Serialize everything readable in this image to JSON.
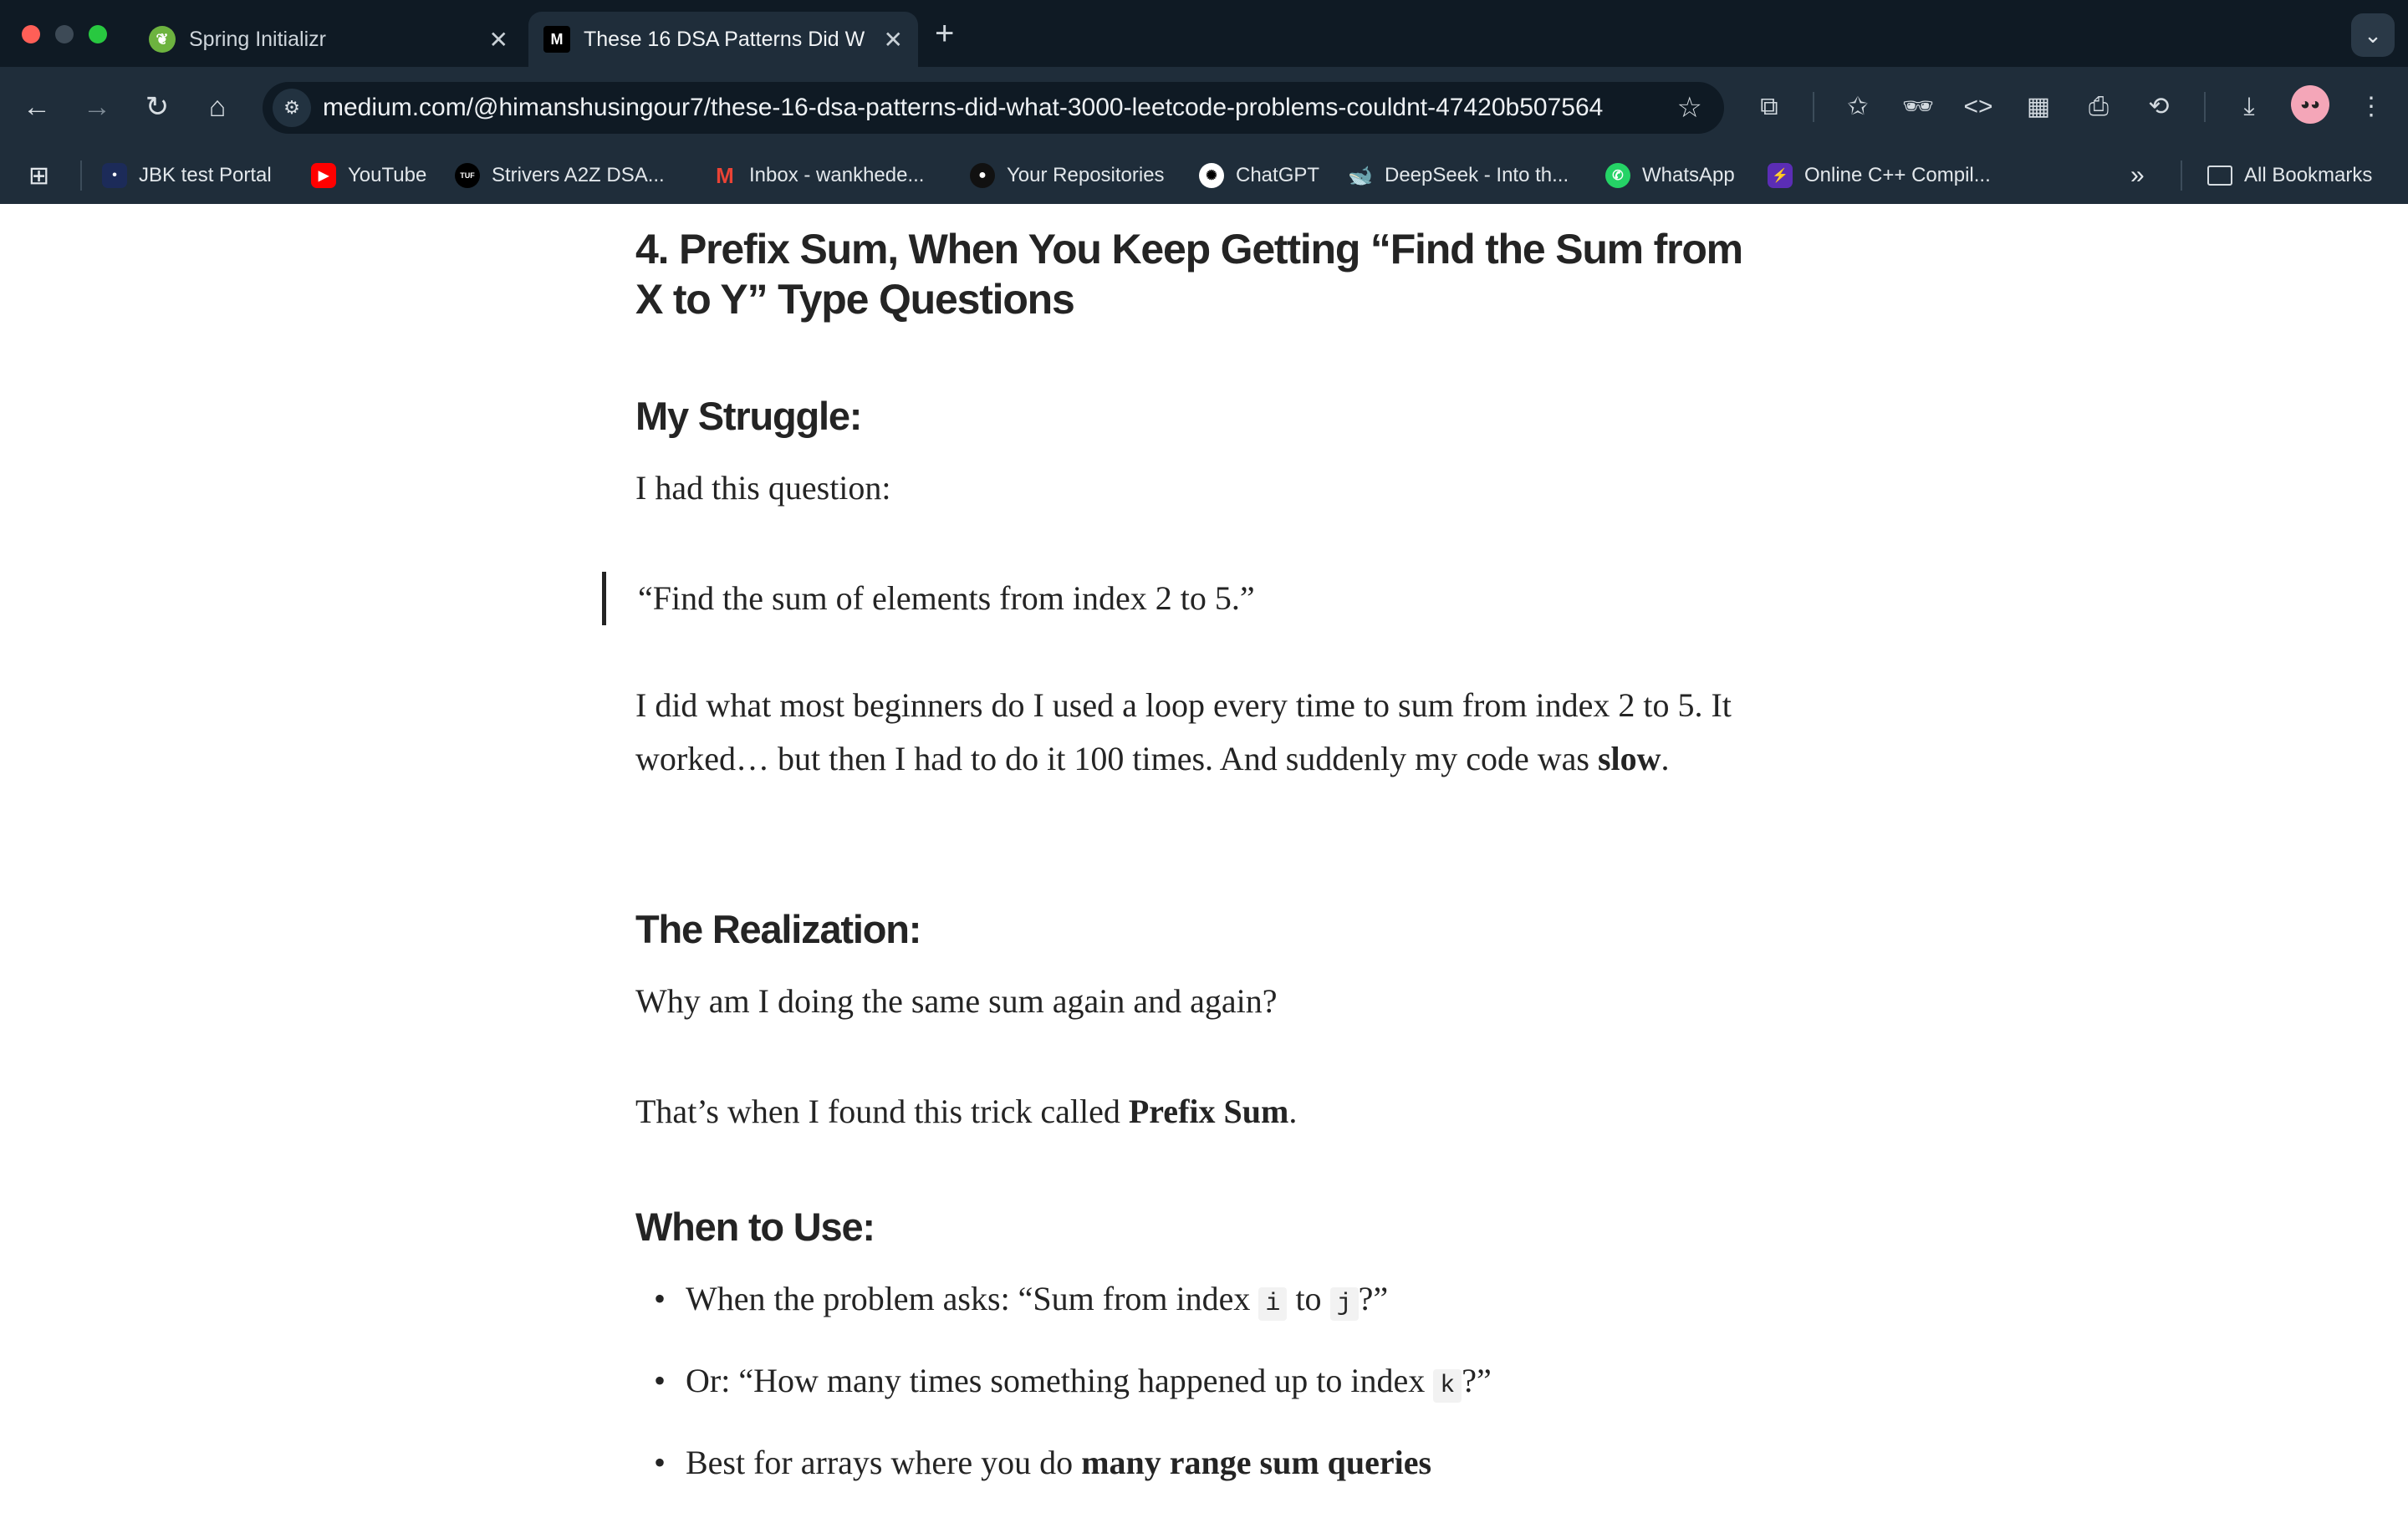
{
  "browser": {
    "tabs": [
      {
        "title": "Spring Initializr",
        "active": false,
        "icon": "spring-leaf-icon",
        "icon_color": "#6db33f"
      },
      {
        "title": "These 16 DSA Patterns Did W",
        "active": true,
        "icon": "medium-logo-icon",
        "icon_text": "M"
      }
    ],
    "new_tab_glyph": "+",
    "url": "medium.com/@himanshusingour7/these-16-dsa-patterns-did-what-3000-leetcode-problems-couldnt-47420b507564",
    "bookmarks": [
      {
        "label": "JBK test Portal",
        "icon": "jbk-icon"
      },
      {
        "label": "YouTube",
        "icon": "youtube-icon",
        "color": "#ff0000"
      },
      {
        "label": "Strivers A2Z DSA...",
        "icon": "tuf-icon",
        "icon_text": "TUF"
      },
      {
        "label": "Inbox - wankhede...",
        "icon": "gmail-icon",
        "icon_text": "M"
      },
      {
        "label": "Your Repositories",
        "icon": "github-icon"
      },
      {
        "label": "ChatGPT",
        "icon": "chatgpt-icon"
      },
      {
        "label": "DeepSeek - Into th...",
        "icon": "deepseek-icon"
      },
      {
        "label": "WhatsApp",
        "icon": "whatsapp-icon",
        "color": "#25d366"
      },
      {
        "label": "Online C++ Compil...",
        "icon": "compiler-icon",
        "color": "#5b2db5"
      }
    ],
    "all_bookmarks": "All Bookmarks"
  },
  "article": {
    "heading": "4. Prefix Sum, When You Keep Getting “Find the Sum from X to Y” Type Questions",
    "struggle_heading": "My Struggle:",
    "struggle_intro": "I had this question:",
    "quote": "“Find the sum of elements from index 2 to 5.”",
    "struggle_body": "I did what most beginners do I used a loop every time to sum from index 2 to 5. It worked… but then I had to do it 100 times. And suddenly my code was ",
    "struggle_bold": "slow",
    "struggle_end": ".",
    "realization_heading": "The Realization:",
    "realization_q": "Why am I doing the same sum again and again?",
    "realization_body": "That’s when I found this trick called ",
    "realization_bold": "Prefix Sum",
    "realization_end": ".",
    "when_heading": "When to Use:",
    "bullets": {
      "b1_pre": "When the problem asks: “Sum from index ",
      "b1_code1": "i",
      "b1_mid": " to ",
      "b1_code2": "j",
      "b1_post": "?”",
      "b2_pre": "Or: “How many times something happened up to index ",
      "b2_code": "k",
      "b2_post": "?”",
      "b3_pre": "Best for arrays where you do ",
      "b3_bold": "many range sum queries"
    }
  }
}
